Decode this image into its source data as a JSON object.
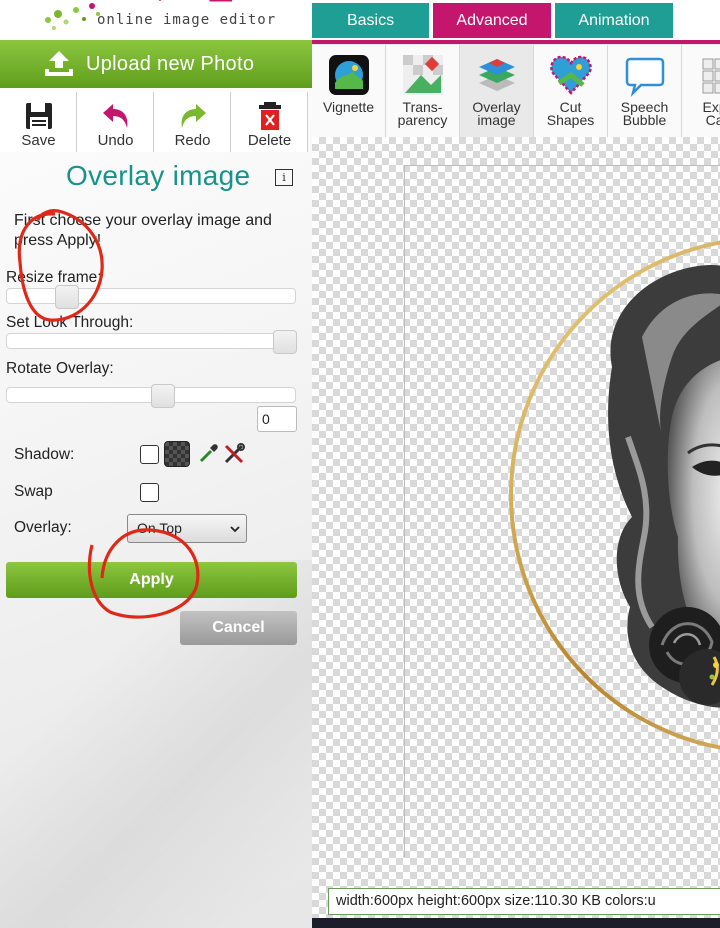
{
  "app": {
    "logo_text": "online image editor"
  },
  "upload": {
    "label": "Upload new Photo"
  },
  "toolbar": {
    "save": "Save",
    "undo": "Undo",
    "redo": "Redo",
    "delete": "Delete"
  },
  "panel": {
    "title": "Overlay image",
    "instructions": "First choose your overlay image and press Apply!",
    "resize_label": "Resize frame:",
    "resize_value": 0.18,
    "look_through_label": "Set Look Through:",
    "look_through_value": 1.0,
    "rotate_label": "Rotate Overlay:",
    "rotate_value": "0",
    "shadow_label": "Shadow:",
    "swap_label": "Swap",
    "overlay_label": "Overlay:",
    "overlay_selected": "On Top",
    "apply": "Apply",
    "cancel": "Cancel"
  },
  "tabs": [
    {
      "label": "Basics",
      "active": false
    },
    {
      "label": "Advanced",
      "active": true
    },
    {
      "label": "Animation",
      "active": false
    }
  ],
  "effects": [
    {
      "label": "Vignette",
      "icon": "vignette-icon"
    },
    {
      "label": "Trans-\nparency",
      "icon": "transparency-icon"
    },
    {
      "label": "Overlay\nimage",
      "icon": "overlay-image-icon",
      "selected": true
    },
    {
      "label": "Cut\nShapes",
      "icon": "cut-shapes-icon"
    },
    {
      "label": "Speech\nBubble",
      "icon": "speech-bubble-icon"
    },
    {
      "label": "Expa\nCan",
      "icon": "expand-canvas-icon"
    }
  ],
  "status": "width:600px  height:600px  size:110.30 KB  colors:u",
  "colors": {
    "accent_green": "#7ab82e",
    "teal": "#1f9e95",
    "magenta": "#c5166e",
    "title_teal": "#19928b"
  }
}
